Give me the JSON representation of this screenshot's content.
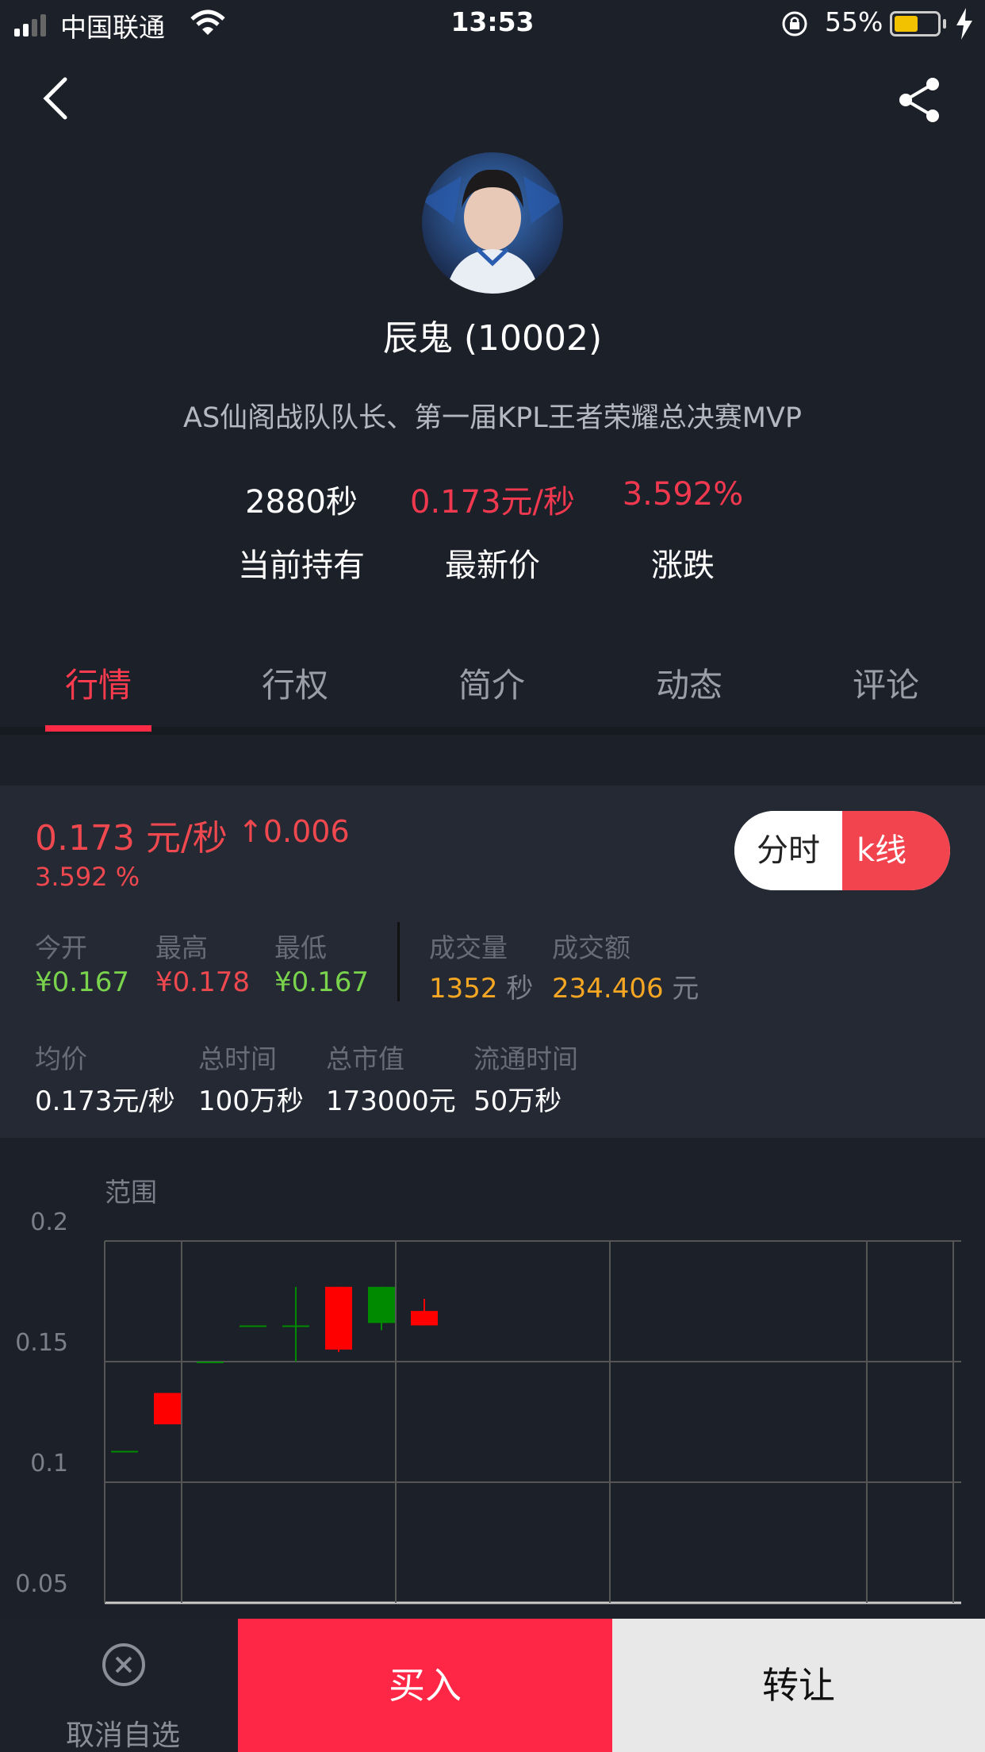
{
  "status_bar": {
    "carrier": "中国联通",
    "time": "13:53",
    "battery_pct": "55%",
    "battery_level": 0.55
  },
  "profile": {
    "name": "辰鬼 (10002)",
    "description": "AS仙阁战队队长、第一届KPL王者荣耀总决赛MVP"
  },
  "stats": [
    {
      "value": "2880秒",
      "label": "当前持有"
    },
    {
      "value": "0.173元/秒",
      "label": "最新价"
    },
    {
      "value": "3.592%",
      "label": "涨跌"
    }
  ],
  "tabs": [
    "行情",
    "行权",
    "简介",
    "动态",
    "评论"
  ],
  "active_tab": "行情",
  "quote": {
    "price": "0.173 元/秒",
    "change": "0.006",
    "change_pct": "3.592 %",
    "toggle": {
      "left": "分时",
      "right": "k线",
      "selected": "k线"
    },
    "open_label": "今开",
    "open_value": "¥0.167",
    "high_label": "最高",
    "high_value": "¥0.178",
    "low_label": "最低",
    "low_value": "¥0.167",
    "volume_label": "成交量",
    "volume_value": "1352",
    "volume_unit": "秒",
    "amount_label": "成交额",
    "amount_value": "234.406",
    "amount_unit": "元",
    "avg_label": "均价",
    "avg_value": "0.173元/秒",
    "total_time_label": "总时间",
    "total_time_value": "100万秒",
    "market_cap_label": "总市值",
    "market_cap_value": "173000元",
    "circulation_label": "流通时间",
    "circulation_value": "50万秒"
  },
  "chart_title": "范围",
  "chart_data": {
    "type": "candlestick",
    "ylim": [
      0.05,
      0.2
    ],
    "y_ticks": [
      "0.2",
      "0.15",
      "0.1",
      "0.05"
    ],
    "candles": [
      {
        "open": 0.113,
        "close": 0.113,
        "high": 0.113,
        "low": 0.113,
        "color": "green"
      },
      {
        "open": 0.137,
        "close": 0.124,
        "high": 0.137,
        "low": 0.124,
        "color": "red"
      },
      {
        "open": 0.15,
        "close": 0.15,
        "high": 0.15,
        "low": 0.15,
        "color": "green"
      },
      {
        "open": 0.165,
        "close": 0.165,
        "high": 0.165,
        "low": 0.165,
        "color": "green"
      },
      {
        "open": 0.165,
        "close": 0.165,
        "high": 0.181,
        "low": 0.15,
        "color": "green"
      },
      {
        "open": 0.181,
        "close": 0.155,
        "high": 0.181,
        "low": 0.154,
        "color": "red"
      },
      {
        "open": 0.181,
        "close": 0.166,
        "high": 0.181,
        "low": 0.163,
        "color": "green"
      },
      {
        "open": 0.171,
        "close": 0.165,
        "high": 0.176,
        "low": 0.165,
        "color": "red"
      }
    ]
  },
  "bottom_bar": {
    "cancel_label": "取消自选",
    "buy_label": "买入",
    "transfer_label": "转让"
  },
  "colors": {
    "accent": "#ff2745",
    "up": "#f0484f",
    "down": "#7ad34c",
    "panel": "#242934"
  }
}
